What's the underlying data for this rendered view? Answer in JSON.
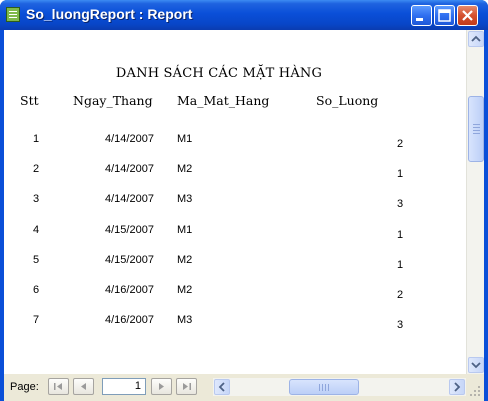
{
  "window": {
    "title": "So_luongReport : Report"
  },
  "report": {
    "heading": "DANH SÁCH CÁC MẶT HÀNG",
    "columns": {
      "stt": "Stt",
      "ngay": "Ngay_Thang",
      "mamh": "Ma_Mat_Hang",
      "soluong": "So_Luong"
    },
    "rows": [
      {
        "stt": "1",
        "ngay": "4/14/2007",
        "mamh": "M1",
        "soluong": "2"
      },
      {
        "stt": "2",
        "ngay": "4/14/2007",
        "mamh": "M2",
        "soluong": "1"
      },
      {
        "stt": "3",
        "ngay": "4/14/2007",
        "mamh": "M3",
        "soluong": "3"
      },
      {
        "stt": "4",
        "ngay": "4/15/2007",
        "mamh": "M1",
        "soluong": "1"
      },
      {
        "stt": "5",
        "ngay": "4/15/2007",
        "mamh": "M2",
        "soluong": "1"
      },
      {
        "stt": "6",
        "ngay": "4/16/2007",
        "mamh": "M2",
        "soluong": "2"
      },
      {
        "stt": "7",
        "ngay": "4/16/2007",
        "mamh": "M3",
        "soluong": "3"
      }
    ]
  },
  "navigation": {
    "page_label": "Page:",
    "page_value": "1"
  },
  "icons": {
    "minimize": "minimize-icon",
    "maximize": "maximize-icon",
    "close": "close-icon",
    "first": "first-page-icon",
    "prev": "previous-page-icon",
    "next": "next-page-icon",
    "last": "last-page-icon"
  },
  "colors": {
    "titlebar": "#0a4fd8",
    "close_button": "#d4502f",
    "scrollbar": "#c6d6f8"
  }
}
